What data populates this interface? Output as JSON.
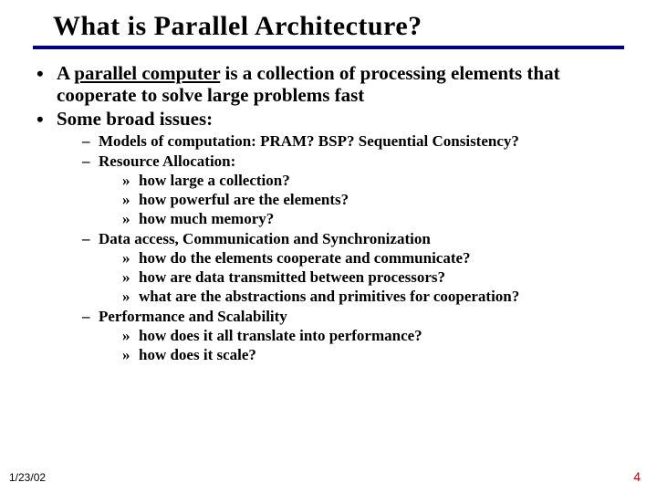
{
  "title": "What is Parallel Architecture?",
  "bullets": {
    "b1_pre": "A ",
    "b1_u": "parallel computer",
    "b1_post": " is a collection of processing elements that cooperate to solve large problems fast",
    "b2": "Some broad issues:",
    "s1": "Models of computation: PRAM? BSP? Sequential Consistency?",
    "s2": "Resource Allocation:",
    "s2a": "how large a collection?",
    "s2b": "how powerful are the elements?",
    "s2c": "how much memory?",
    "s3": "Data access, Communication and Synchronization",
    "s3a": "how do the elements  cooperate and communicate?",
    "s3b": "how are  data transmitted between processors?",
    "s3c": "what are the abstractions and primitives for cooperation?",
    "s4": "Performance and Scalability",
    "s4a": "how does it all translate into performance?",
    "s4b": "how does it scale?"
  },
  "footer": {
    "date": "1/23/02",
    "page": "4"
  }
}
